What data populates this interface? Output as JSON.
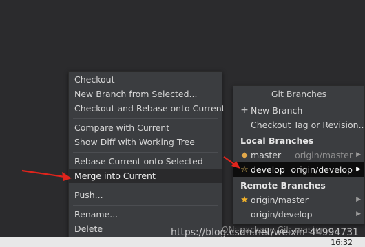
{
  "context_menu": {
    "items": [
      {
        "label": "Checkout"
      },
      {
        "label": "New Branch from Selected..."
      },
      {
        "label": "Checkout and Rebase onto Current"
      },
      {
        "label": "Compare with Current"
      },
      {
        "label": "Show Diff with Working Tree"
      },
      {
        "label": "Rebase Current onto Selected"
      },
      {
        "label": "Merge into Current"
      },
      {
        "label": "Push..."
      },
      {
        "label": "Rename..."
      },
      {
        "label": "Delete"
      }
    ]
  },
  "git_branches": {
    "title": "Git Branches",
    "actions": [
      {
        "label": "New Branch",
        "icon": "plus-icon"
      },
      {
        "label": "Checkout Tag or Revision..."
      }
    ],
    "local_header": "Local Branches",
    "local": [
      {
        "name": "master",
        "tracking": "origin/master",
        "icon": "tag-icon"
      },
      {
        "name": "develop",
        "tracking": "origin/develop",
        "icon": "star-outline-icon",
        "selected": true
      }
    ],
    "remote_header": "Remote Branches",
    "remote": [
      {
        "name": "origin/master",
        "icon": "star-icon"
      },
      {
        "name": "origin/develop"
      }
    ]
  },
  "status_bar": {
    "text": "ON: package   Git: master"
  },
  "watermark": "https://blog.csdn.net/weixin_44994731",
  "taskbar": {
    "clock": "16:32"
  },
  "colors": {
    "menu_bg": "#3b3d40",
    "highlight_bg": "#2a2a2c",
    "selected_row_bg": "#0d0d0d",
    "arrow_red": "#e0241c",
    "star": "#f0b12b"
  }
}
